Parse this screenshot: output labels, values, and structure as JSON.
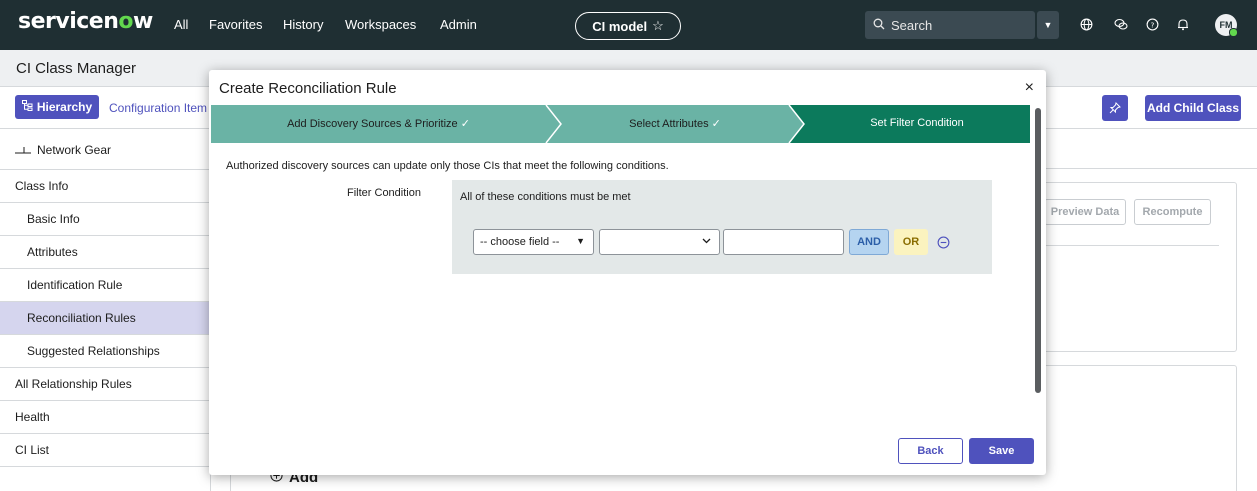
{
  "topnav": {
    "logo_prefix": "servicen",
    "logo_o": "o",
    "logo_suffix": "w",
    "links": [
      "All",
      "Favorites",
      "History",
      "Workspaces",
      "Admin"
    ],
    "context_pill": "CI model",
    "context_star_icon": "star-icon",
    "search_label": "Search",
    "avatar_initials": "FM"
  },
  "app": {
    "title": "CI Class Manager"
  },
  "toolbar": {
    "hierarchy_label": "Hierarchy",
    "breadcrumb": "Configuration Item",
    "add_child_label": "Add Child Class"
  },
  "sidebar": {
    "header": "Network Gear",
    "items": [
      {
        "label": "Class Info",
        "level": "top",
        "active": false
      },
      {
        "label": "Basic Info",
        "level": "sub",
        "active": false
      },
      {
        "label": "Attributes",
        "level": "sub",
        "active": false
      },
      {
        "label": "Identification Rule",
        "level": "sub",
        "active": false
      },
      {
        "label": "Reconciliation Rules",
        "level": "sub",
        "active": true
      },
      {
        "label": "Suggested Relationships",
        "level": "sub",
        "active": false
      },
      {
        "label": "All Relationship Rules",
        "level": "top",
        "active": false
      },
      {
        "label": "Health",
        "level": "top",
        "active": false
      },
      {
        "label": "CI List",
        "level": "top",
        "active": false
      }
    ]
  },
  "background": {
    "preview_data": "Preview Data",
    "recompute": "Recompute",
    "add_label": "Add"
  },
  "modal": {
    "title": "Create Reconciliation Rule",
    "steps": [
      {
        "label": "Add Discovery Sources & Prioritize",
        "done": true
      },
      {
        "label": "Select Attributes",
        "done": true
      },
      {
        "label": "Set Filter Condition",
        "done": false
      }
    ],
    "description": "Authorized discovery sources can update only those CIs that meet the following conditions.",
    "filter_label": "Filter Condition",
    "condition_title": "All of these conditions must be met",
    "field_select": "-- choose field --",
    "operator_select": "",
    "value_input": "",
    "and_label": "AND",
    "or_label": "OR",
    "back_label": "Back",
    "save_label": "Save"
  },
  "colors": {
    "nav_bg": "#1f2f33",
    "accent": "#4f52bd",
    "step_done": "#6ab3a5",
    "step_active": "#0c7a5c",
    "logo_green": "#62d84e"
  }
}
